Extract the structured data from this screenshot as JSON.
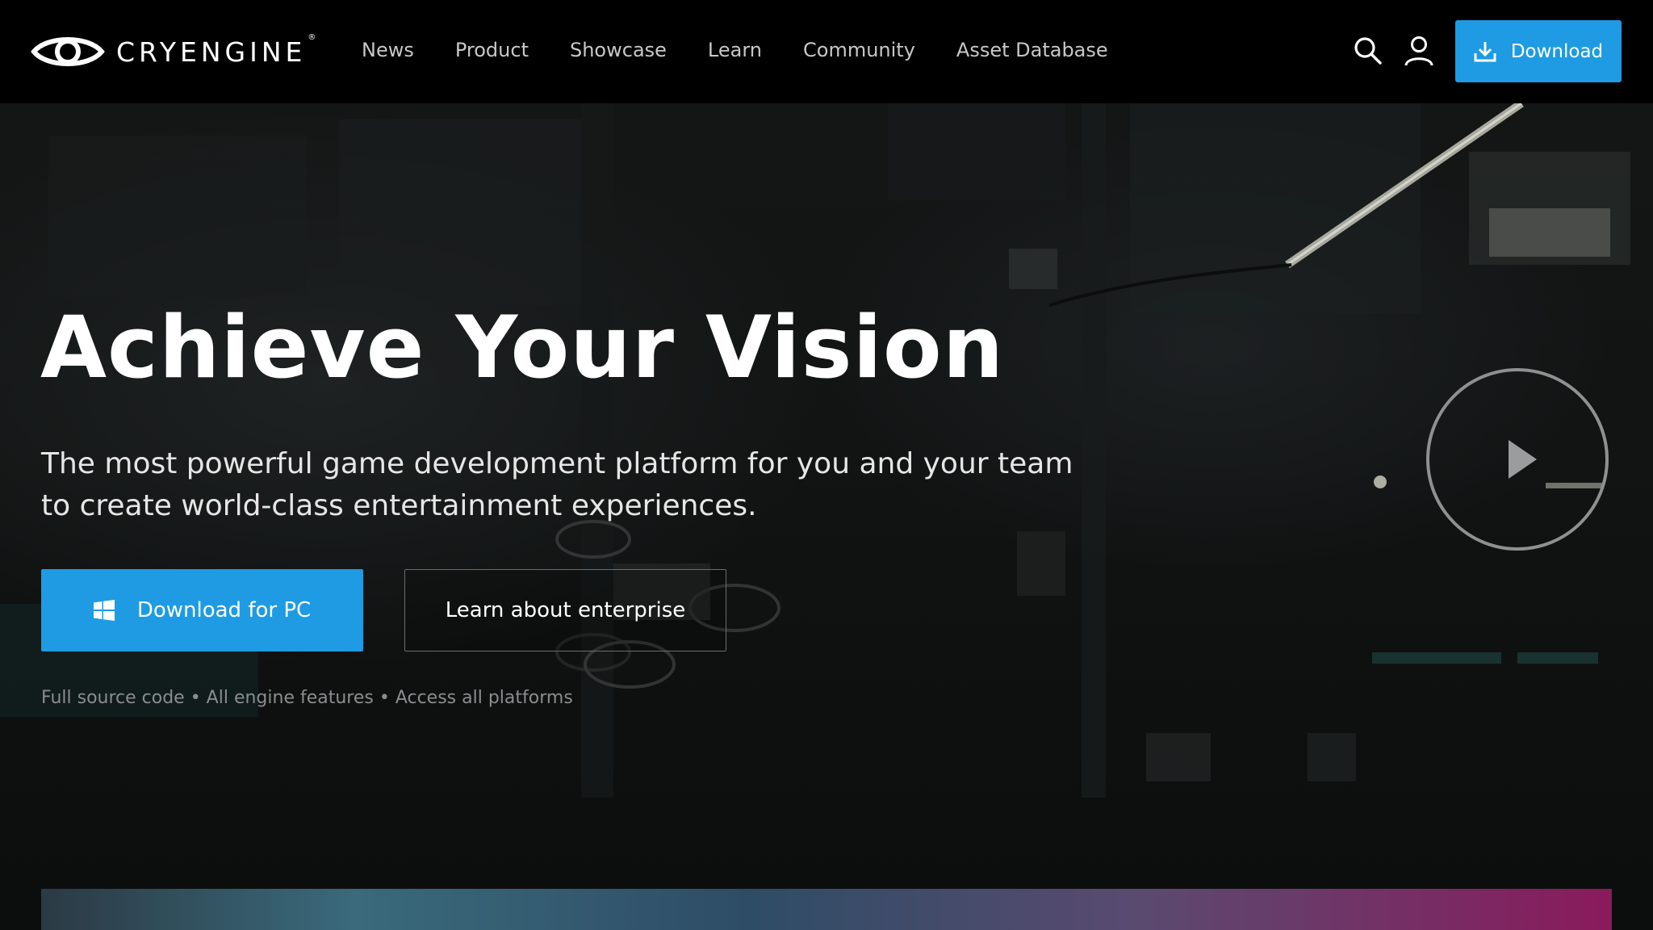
{
  "brand": {
    "logo_text": "CRYENGINE",
    "registered_mark": "®"
  },
  "nav": {
    "links": [
      "News",
      "Product",
      "Showcase",
      "Learn",
      "Community",
      "Asset Database"
    ],
    "search_icon": "search-icon",
    "user_icon": "user-icon",
    "download_label": "Download"
  },
  "hero": {
    "title": "Achieve Your Vision",
    "subtitle": "The most powerful game development platform for you and your team to create world-class entertainment experiences.",
    "primary_button": "Download for PC",
    "secondary_button": "Learn about enterprise",
    "features": "Full source code • All engine features • Access all platforms",
    "play_icon": "play-icon"
  },
  "colors": {
    "accent": "#1e9be3",
    "nav_bg": "#000000",
    "hero_bg": "#121414"
  }
}
